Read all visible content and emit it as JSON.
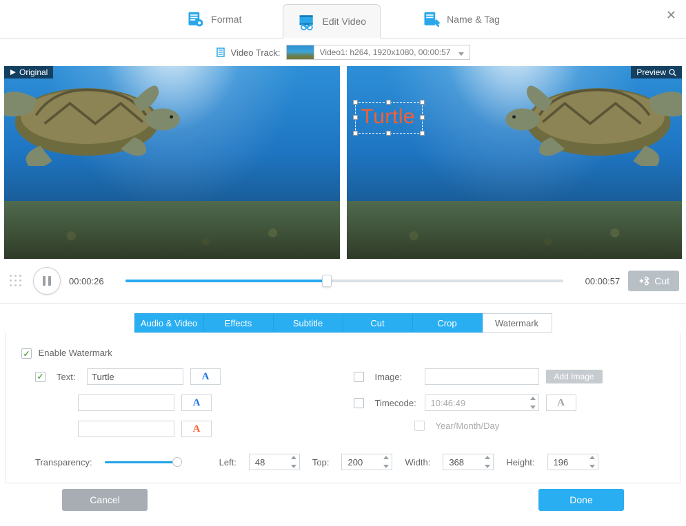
{
  "top_tabs": {
    "format": "Format",
    "edit": "Edit Video",
    "name": "Name & Tag"
  },
  "track": {
    "label": "Video Track:",
    "value": "Video1: h264, 1920x1080, 00:00:57"
  },
  "preview": {
    "original": "Original",
    "preview": "Preview"
  },
  "watermark_overlay": "Turtle",
  "playback": {
    "current": "00:00:26",
    "total": "00:00:57",
    "cut": "Cut"
  },
  "sub_tabs": {
    "av": "Audio & Video",
    "fx": "Effects",
    "sub": "Subtitle",
    "cut": "Cut",
    "crop": "Crop",
    "wm": "Watermark"
  },
  "panel": {
    "enable": "Enable Watermark",
    "text_label": "Text:",
    "text_value": "Turtle",
    "image_label": "Image:",
    "add_image": "Add Image",
    "timecode_label": "Timecode:",
    "timecode_value": "10:46:49",
    "ymd": "Year/Month/Day",
    "transparency": "Transparency:",
    "left": "Left:",
    "left_v": "48",
    "top": "Top:",
    "top_v": "200",
    "width": "Width:",
    "width_v": "368",
    "height": "Height:",
    "height_v": "196"
  },
  "footer": {
    "cancel": "Cancel",
    "done": "Done"
  }
}
